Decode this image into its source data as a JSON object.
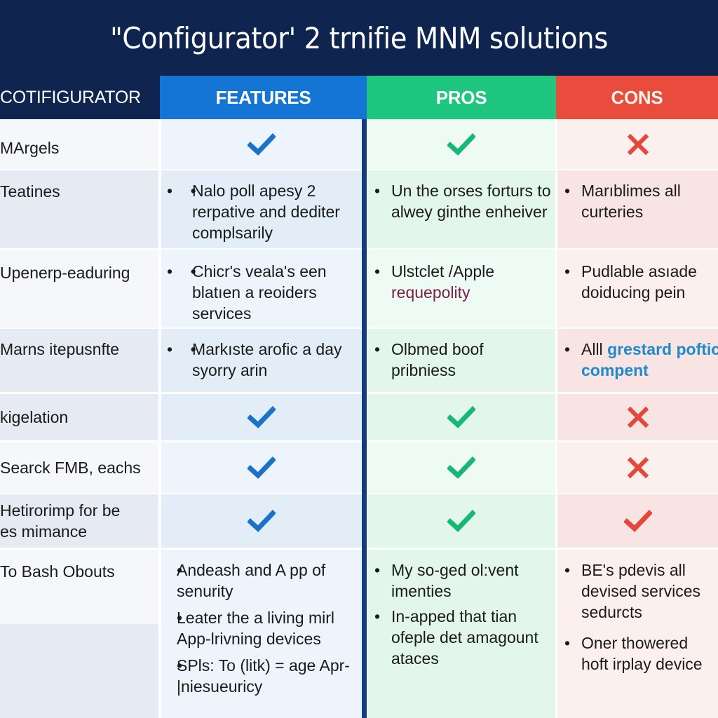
{
  "title": "\"Configurator' 2 trnifie MNM solutions",
  "headers": {
    "configurator": "COTIFIGURATOR",
    "features": "FEATURES",
    "pros": "PROS",
    "cons": "CONS"
  },
  "colors": {
    "background": "#0f254f",
    "features": "#1575d4",
    "pros": "#1ec680",
    "cons": "#e94b3c",
    "check_blue": "#1b72c9",
    "check_green": "#17b876",
    "cross_red": "#e3483a"
  },
  "rows": [
    {
      "label": "MArgels",
      "features": {
        "icon": "check-icon"
      },
      "pros": {
        "icon": "check-icon"
      },
      "cons": {
        "icon": "cross-icon"
      }
    },
    {
      "label": "Teatines",
      "features": {
        "bullets": [
          "Nalo poll apesy 2 rerpative and dediter complsarily"
        ]
      },
      "pros": {
        "bullets": [
          "Un the orses forturs to alwey ginthe enheiver"
        ]
      },
      "cons": {
        "bullets": [
          "Marıblimes all curteries"
        ]
      }
    },
    {
      "label": "Upenerp-eaduring",
      "features": {
        "bullets": [
          "Chicr's veala's een blatıen a reoiders services"
        ]
      },
      "pros": {
        "bullets": [
          "Ulstclet /Apple"
        ],
        "accent": "requepolity"
      },
      "cons": {
        "bullets": [
          "Pudlable asıade doiducing pein"
        ]
      }
    },
    {
      "label": "Marns itepusnfte",
      "features": {
        "bullets": [
          "Markıste arofic a day syorry arin"
        ]
      },
      "pros": {
        "bullets": [
          "Olbmed boof pribniess"
        ]
      },
      "cons": {
        "bullets": [
          "Alll"
        ],
        "accent": "grestard poftic compent"
      }
    },
    {
      "label": "kigelation",
      "features": {
        "icon": "check-icon"
      },
      "pros": {
        "icon": "check-icon"
      },
      "cons": {
        "icon": "cross-icon"
      }
    },
    {
      "label": "Searck FMB, eachs",
      "features": {
        "icon": "check-icon"
      },
      "pros": {
        "icon": "check-icon"
      },
      "cons": {
        "icon": "cross-icon"
      }
    },
    {
      "label": "Hetirorimp for be es mimance",
      "features": {
        "icon": "check-icon"
      },
      "pros": {
        "icon": "check-icon"
      },
      "cons": {
        "icon": "check-icon"
      }
    },
    {
      "label": "To Bash Obouts",
      "features": {
        "bullets": [
          "Andeash and A pp of senurity",
          "Leater the a living mirl App-lrivning devices",
          "SPls: To (litk) = age Apr-|niesueuricy"
        ]
      },
      "pros": {
        "bullets": [
          "My so-ged ol:vent imenties",
          "In-apped that tian ofeple det amagount ataces"
        ]
      },
      "cons": {
        "bullets": [
          "BE's pdevis all devised services sedurcts",
          "Oner thowered hoft irplay device"
        ]
      }
    }
  ]
}
